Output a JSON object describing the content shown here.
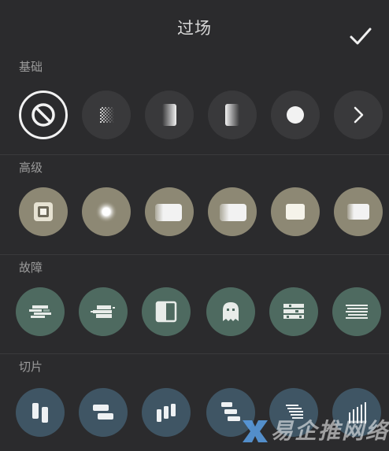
{
  "header": {
    "title": "过场",
    "confirm_icon": "checkmark-icon"
  },
  "sections": [
    {
      "label": "基础",
      "items": [
        "none-icon",
        "checker-gradient-icon",
        "fade-left-icon",
        "fade-right-icon",
        "dot-icon",
        "chevron-right-icon"
      ]
    },
    {
      "label": "高级",
      "items": [
        "zoom-square-icon",
        "blur-square-icon",
        "blur-left-icon",
        "blur-right-icon",
        "square-icon",
        "blur-fade-square-icon"
      ]
    },
    {
      "label": "故障",
      "items": [
        "glitch-bars-icon",
        "glitch-shift-icon",
        "split-square-icon",
        "ghost-icon",
        "glitch-blocks-icon",
        "glitch-lines-icon"
      ]
    },
    {
      "label": "切片",
      "items": [
        "vertical-slices-icon",
        "horizontal-slices-icon",
        "staggered-bars-icon",
        "staggered-blocks-icon",
        "diagonal-lines-icon",
        "vertical-lines-icon"
      ]
    }
  ],
  "colors": {
    "background": "#2b2b2d",
    "basic": "#39393b",
    "advanced": "#8d8874",
    "glitch": "#4e6a60",
    "slice": "#3f5564"
  },
  "watermark": {
    "text": "易企推网络"
  }
}
